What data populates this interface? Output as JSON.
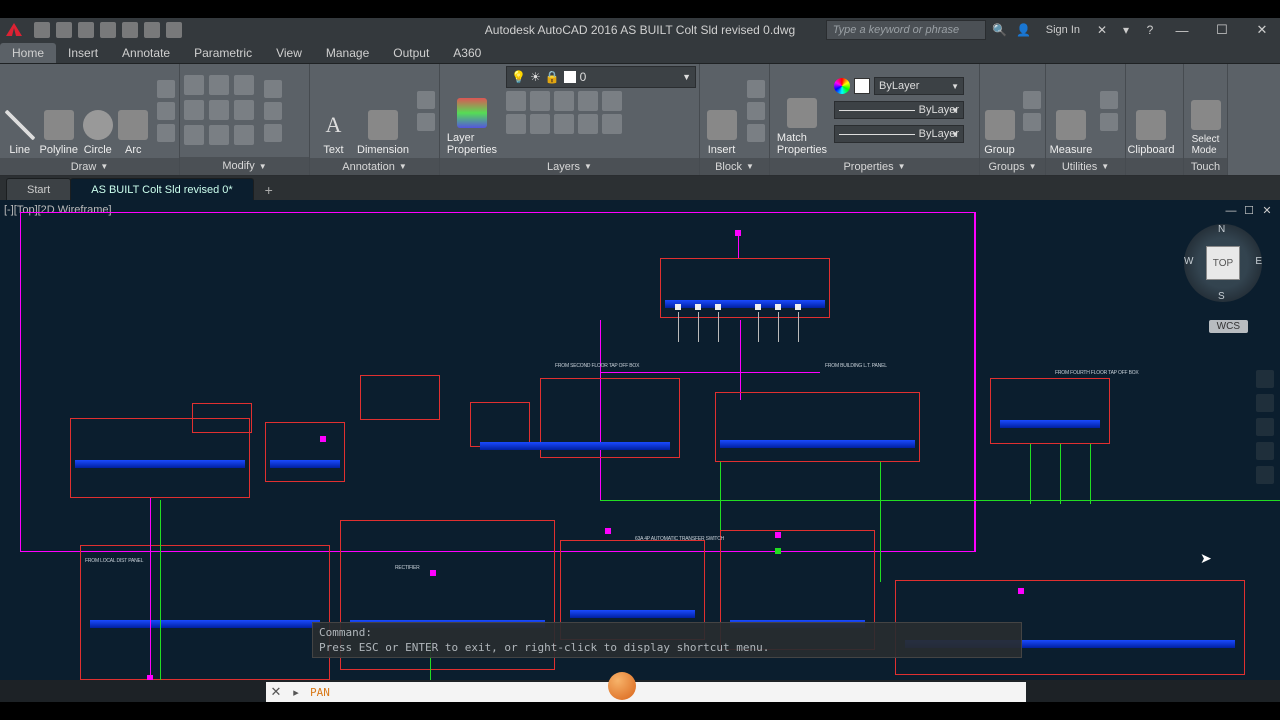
{
  "app_title": "Autodesk AutoCAD 2016   AS BUILT Colt Sld revised 0.dwg",
  "search_placeholder": "Type a keyword or phrase",
  "signin_label": "Sign In",
  "menu_tabs": [
    "Home",
    "Insert",
    "Annotate",
    "Parametric",
    "View",
    "Manage",
    "Output",
    "A360"
  ],
  "active_menu_tab": 0,
  "ribbon_panels": {
    "draw": {
      "title": "Draw",
      "items": [
        "Line",
        "Polyline",
        "Circle",
        "Arc"
      ]
    },
    "modify": {
      "title": "Modify"
    },
    "annotation": {
      "title": "Annotation",
      "items": [
        "Text",
        "Dimension"
      ]
    },
    "layers": {
      "title": "Layers",
      "btn": "Layer\nProperties",
      "current": "0"
    },
    "block": {
      "title": "Block",
      "btn": "Insert"
    },
    "properties": {
      "title": "Properties",
      "btn": "Match\nProperties",
      "vals": [
        "ByLayer",
        "ByLayer",
        "ByLayer"
      ]
    },
    "groups": {
      "title": "Groups",
      "btn": "Group"
    },
    "utilities": {
      "title": "Utilities",
      "btn": "Measure"
    },
    "clipboard": {
      "title": "Clipboard",
      "btn": "Clipboard"
    },
    "select": {
      "btn": "Select\nMode",
      "title": ""
    },
    "touch": {
      "title": "Touch"
    }
  },
  "doc_tabs": {
    "items": [
      "Start",
      "AS BUILT Colt Sld revised 0*"
    ],
    "active": 1
  },
  "viewport_label": "[-][Top][2D Wireframe]",
  "viewcube": {
    "face": "TOP",
    "n": "N",
    "s": "S",
    "e": "E",
    "w": "W"
  },
  "wcs_label": "WCS",
  "command_history": [
    "Command:",
    "Press ESC or ENTER to exit, or right-click to display shortcut menu."
  ],
  "command_prompt": "PAN",
  "colors": {
    "bg": "#0b1e2e",
    "magenta": "#f0f",
    "green": "#2d2",
    "red": "#e03030",
    "blue": "#39f"
  }
}
